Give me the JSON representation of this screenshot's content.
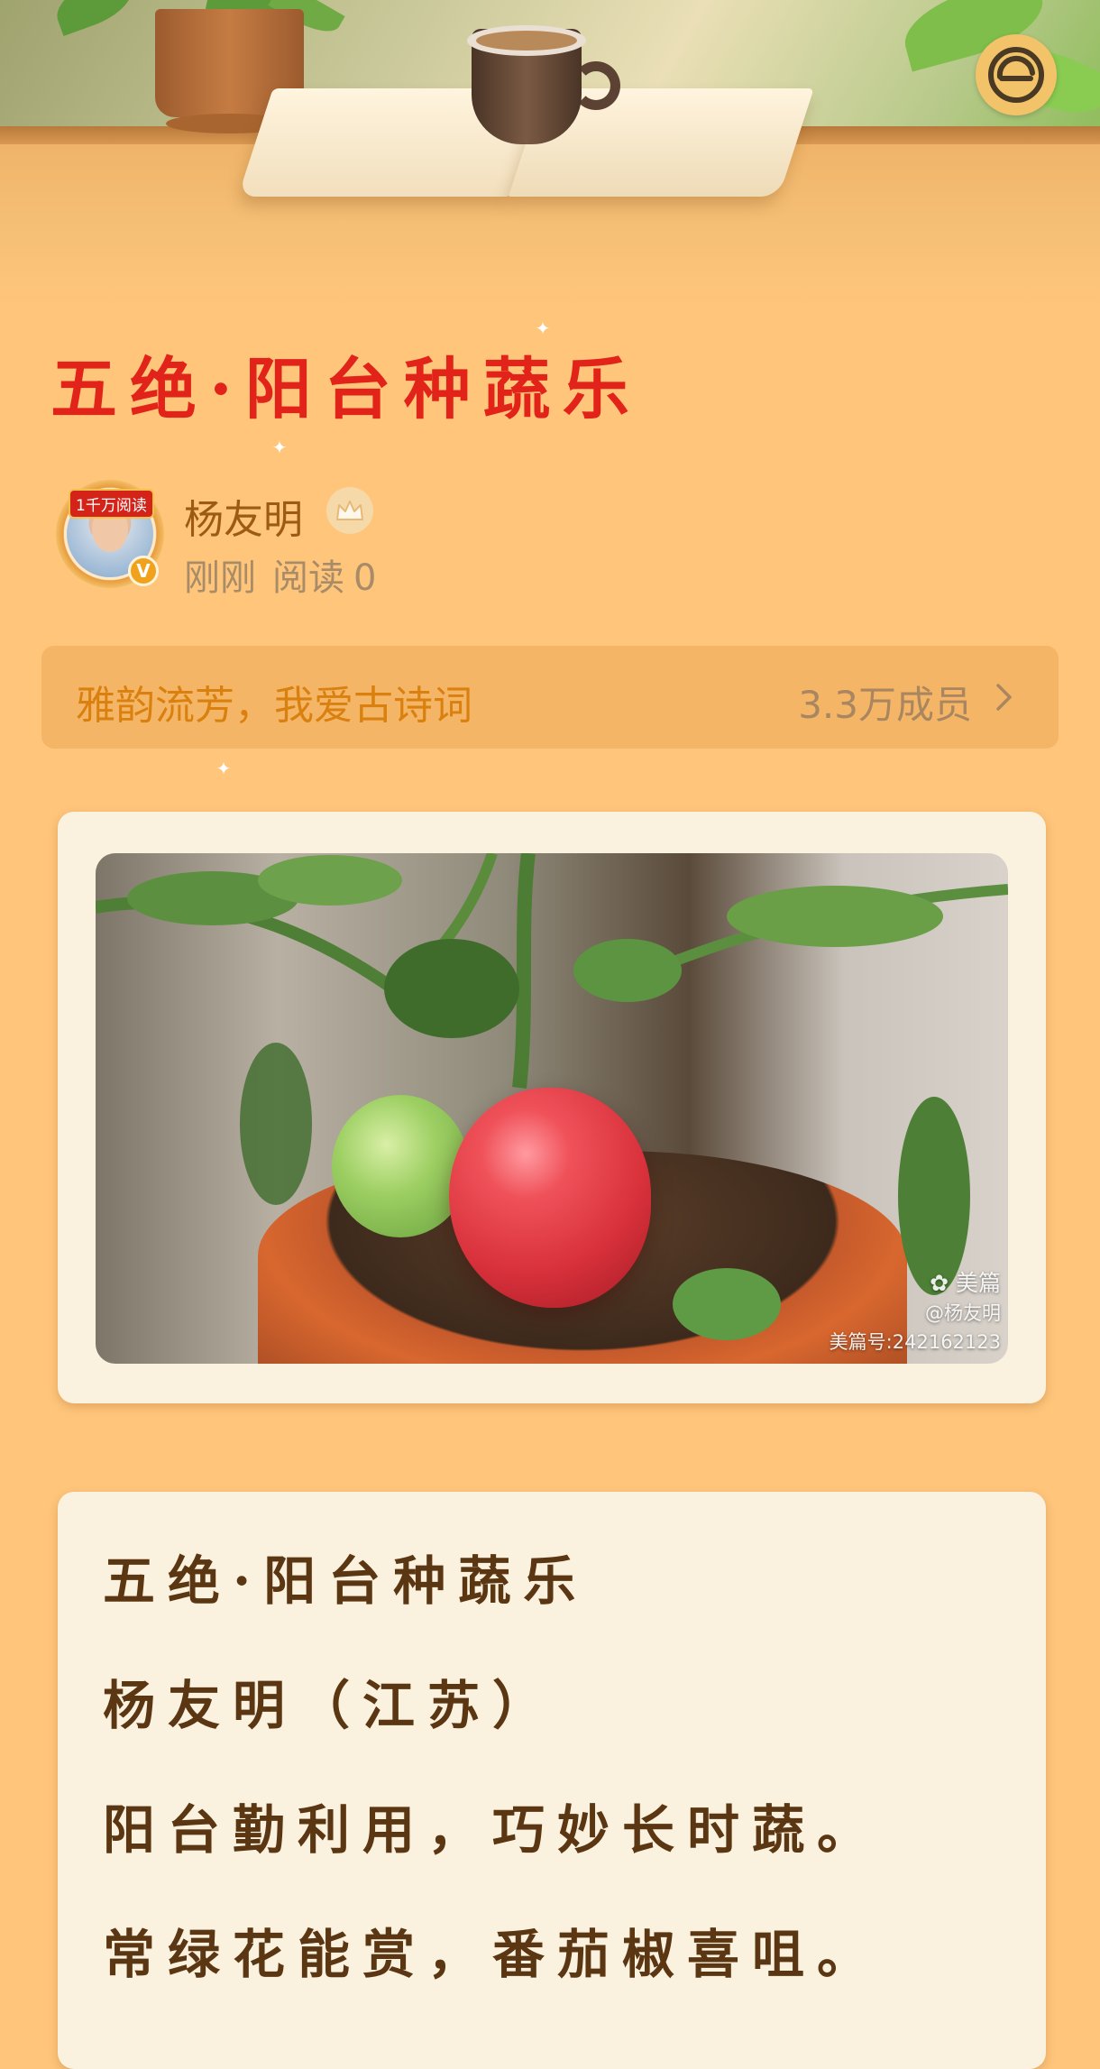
{
  "article": {
    "title": "五绝·阳台种蔬乐"
  },
  "author": {
    "name": "杨友明",
    "avatar_badge": "1千万阅读",
    "verified_mark": "V",
    "time": "刚刚",
    "read_label": "阅读",
    "read_count": "0"
  },
  "group": {
    "name": "雅韵流芳，我爱古诗词",
    "member_count": "3.3万成员"
  },
  "photo": {
    "watermark_brand": "美篇",
    "watermark_user": "@杨友明",
    "watermark_id": "美篇号:242162123"
  },
  "poem": {
    "lines": [
      "五绝·阳台种蔬乐",
      "杨友明（江苏）",
      "阳台勤利用，巧妙长时蔬。",
      "常绿花能赏，番茄椒喜咀。"
    ]
  },
  "icons": {
    "logo": "brand-logo-icon",
    "crown": "crown-icon",
    "chevron": "chevron-right-icon",
    "verified": "verified-icon"
  },
  "colors": {
    "background": "#ffc57b",
    "title": "#e2231a",
    "author_name": "#9c5a12",
    "group_name": "#d9800e",
    "card": "#fbf1df",
    "poem_text": "#5a3612"
  }
}
